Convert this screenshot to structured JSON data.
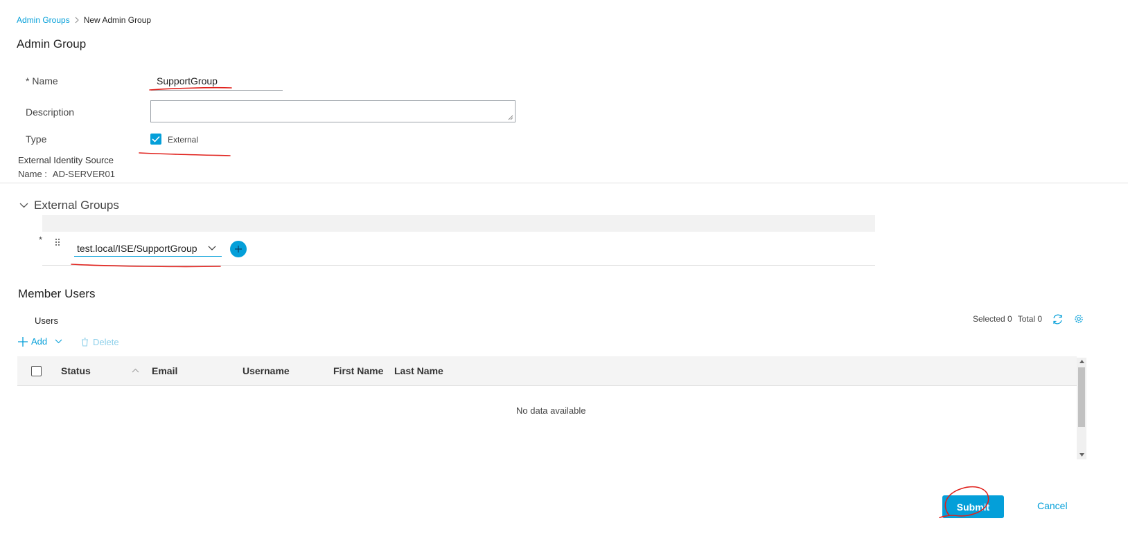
{
  "breadcrumb": {
    "parent": "Admin Groups",
    "separator": ">",
    "current": "New Admin Group"
  },
  "page_title": "Admin Group",
  "form": {
    "name_label": "* Name",
    "name_value": "SupportGroup",
    "description_label": "Description",
    "description_value": "",
    "type_label": "Type",
    "type_checkbox_label": "External",
    "type_checked": true
  },
  "identity_source": {
    "heading": "External Identity Source",
    "name_label": "Name :",
    "name_value": "AD-SERVER01"
  },
  "external_groups": {
    "title": "External Groups",
    "required_marker": "*",
    "selected_group": "test.local/ISE/SupportGroup"
  },
  "member_users": {
    "title": "Member Users",
    "users_label": "Users",
    "selected_text": "Selected 0",
    "total_text": "Total 0",
    "add_label": "Add",
    "delete_label": "Delete",
    "columns": [
      "Status",
      "Email",
      "Username",
      "First Name",
      "Last Name"
    ],
    "empty_text": "No data available"
  },
  "footer": {
    "submit_label": "Submit",
    "cancel_label": "Cancel"
  },
  "colors": {
    "accent": "#049fd9",
    "annotation": "#e0201b"
  }
}
